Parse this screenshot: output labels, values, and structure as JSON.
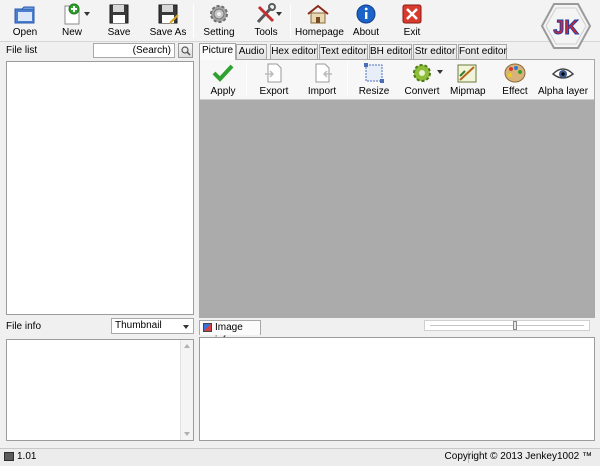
{
  "toolbar": {
    "open": "Open",
    "new": "New",
    "save": "Save",
    "save_as": "Save As",
    "setting": "Setting",
    "tools": "Tools",
    "homepage": "Homepage",
    "about": "About",
    "exit": "Exit"
  },
  "logo": {
    "text": "JK"
  },
  "file_list": {
    "label": "File list",
    "search_placeholder": "(Search)"
  },
  "file_info": {
    "label": "File info",
    "view_mode": "Thumbnail"
  },
  "tabs": [
    "Picture",
    "Audio",
    "Hex editor",
    "Text editor",
    "BH editor",
    "Str editor",
    "Font editor"
  ],
  "picture_toolbar": {
    "apply": "Apply",
    "export": "Export",
    "import": "Import",
    "resize": "Resize",
    "convert": "Convert",
    "mipmap": "Mipmap",
    "effect": "Effect",
    "alpha_layer": "Alpha layer"
  },
  "image_info": {
    "label": "Image info",
    "zoom_level": 0.55
  },
  "status": {
    "version": "1.01",
    "copyright": "Copyright © 2013 Jenkey1002 ™"
  },
  "colors": {
    "canvas": "#ababab",
    "logo_red": "#d9232e",
    "logo_blue": "#1f3fa8",
    "apply_green": "#2ea12e",
    "about_blue": "#1c63c9",
    "exit_red": "#d93a2e"
  },
  "icons": [
    "folder-open-icon",
    "new-file-icon",
    "floppy-disk-icon",
    "floppy-disk-pen-icon",
    "gear-icon",
    "wrench-screwdriver-icon",
    "house-icon",
    "info-icon",
    "exit-cross-icon",
    "checkmark-icon",
    "document-export-icon",
    "document-import-icon",
    "resize-icon",
    "convert-gear-icon",
    "mipmap-icon",
    "palette-icon",
    "eye-icon",
    "magnifier-icon"
  ]
}
